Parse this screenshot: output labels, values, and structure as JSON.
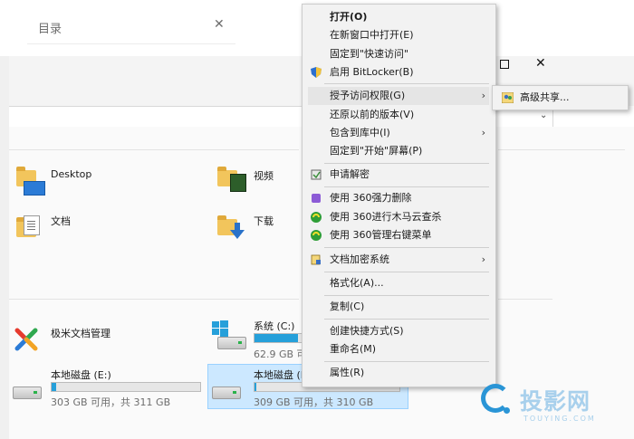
{
  "background_window": {
    "toc_label": "目录",
    "folders": [
      {
        "label": "Desktop",
        "icon": "desktop-folder-icon"
      },
      {
        "label": "视频",
        "icon": "videos-folder-icon"
      },
      {
        "label": "文档",
        "icon": "documents-folder-icon"
      },
      {
        "label": "下载",
        "icon": "downloads-folder-icon"
      }
    ],
    "app_label": "极米文档管理",
    "drives": [
      {
        "label": "系统 (C:)",
        "sub": "62.9 GB 可用",
        "fill": 0.8
      },
      {
        "label": "本地磁盘 (E:)",
        "sub": "303 GB 可用，共 311 GB",
        "fill": 0.03
      },
      {
        "label": "本地磁盘 (F",
        "sub": "309 GB 可用，共 310 GB",
        "fill": 0.01
      }
    ]
  },
  "context_menu": {
    "items": [
      {
        "label": "打开(O)",
        "bold": true
      },
      {
        "label": "在新窗口中打开(E)"
      },
      {
        "label": "固定到\"快速访问\""
      },
      {
        "label": "启用 BitLocker(B)",
        "icon": "shield-icon"
      },
      {
        "label": "授予访问权限(G)",
        "has_submenu": true
      },
      {
        "label": "还原以前的版本(V)"
      },
      {
        "label": "包含到库中(I)",
        "has_submenu": true
      },
      {
        "label": "固定到\"开始\"屏幕(P)"
      },
      {
        "label": "申请解密",
        "icon": "decrypt-icon"
      },
      {
        "label": "使用 360强力删除",
        "icon": "360-delete-icon"
      },
      {
        "label": "使用 360进行木马云查杀",
        "icon": "360-scan-icon"
      },
      {
        "label": "使用 360管理右键菜单",
        "icon": "360-menu-icon"
      },
      {
        "label": "文档加密系统",
        "icon": "encrypt-system-icon",
        "has_submenu": true
      },
      {
        "label": "格式化(A)..."
      },
      {
        "label": "复制(C)"
      },
      {
        "label": "创建快捷方式(S)"
      },
      {
        "label": "重命名(M)"
      },
      {
        "label": "属性(R)"
      }
    ]
  },
  "submenu": {
    "label": "高级共享...",
    "icon": "users-share-icon"
  },
  "watermark": {
    "text": "投影网",
    "sub": "TOUYING.COM"
  },
  "colors": {
    "accent": "#26a0da",
    "selection": "#cce8ff",
    "menu_bg": "#f2f2f2"
  }
}
